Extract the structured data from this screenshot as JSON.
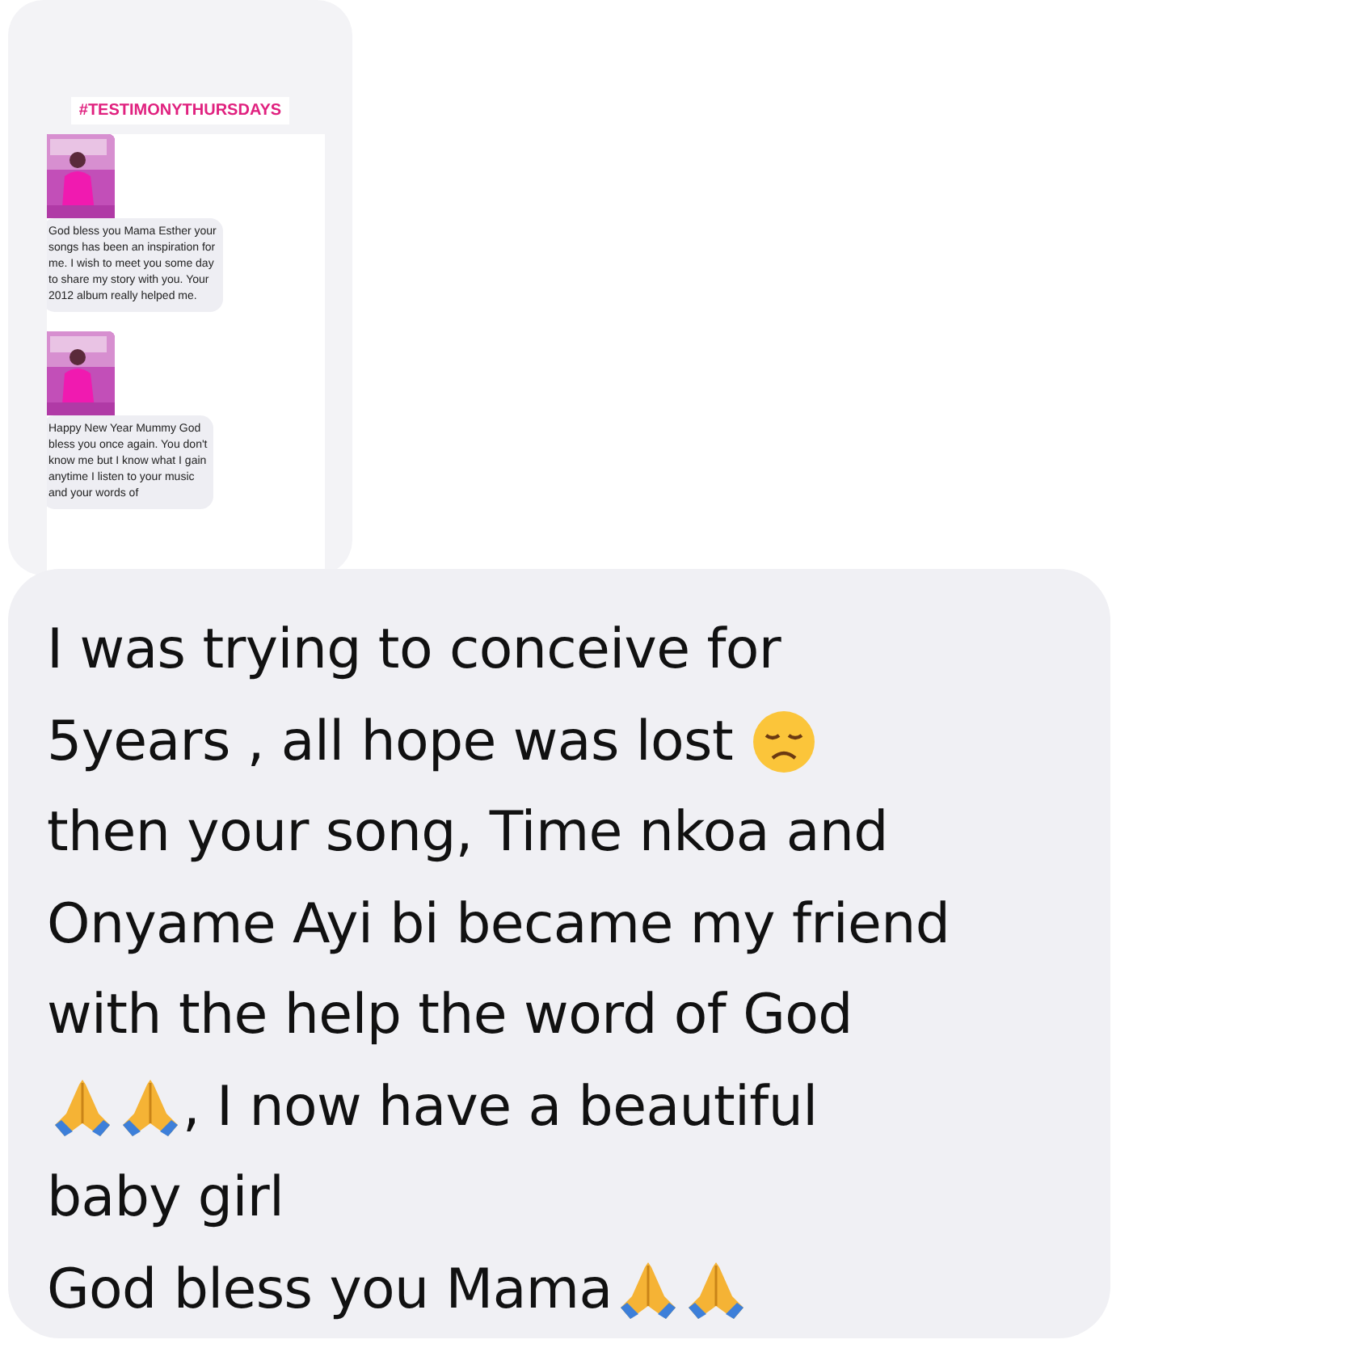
{
  "shared_story": {
    "hashtag": "#TESTIMONYTHURSDAYS",
    "comments": [
      {
        "lines": [
          "God bless you Mama Esther your",
          "songs has been an inspiration for",
          "me. I wish to meet you some day",
          "to share my story with you. Your",
          "2012 album really helped me."
        ]
      },
      {
        "lines": [
          "Happy New Year Mummy God",
          "bless you once again. You don't",
          "know me but I know what I gain",
          "anytime I listen to your music",
          "and your words of"
        ]
      }
    ]
  },
  "message": {
    "lines": [
      [
        {
          "kind": "text",
          "text": "I was trying to conceive for"
        }
      ],
      [
        {
          "kind": "text",
          "text": "5years , all hope was lost"
        },
        {
          "kind": "sad_emoji"
        }
      ],
      [
        {
          "kind": "text",
          "text": "then your song, Time nkoa and"
        }
      ],
      [
        {
          "kind": "text",
          "text": "Onyame Ayi bi became my friend"
        }
      ],
      [
        {
          "kind": "text",
          "text": "with the help the word of God"
        }
      ],
      [
        {
          "kind": "pray_emoji"
        },
        {
          "kind": "pray_emoji"
        },
        {
          "kind": "text",
          "text": ", I now have a beautiful"
        }
      ],
      [
        {
          "kind": "text",
          "text": "baby girl"
        }
      ],
      [
        {
          "kind": "text",
          "text": "God bless you Mama"
        },
        {
          "kind": "pray_emoji"
        },
        {
          "kind": "pray_emoji"
        }
      ]
    ]
  }
}
